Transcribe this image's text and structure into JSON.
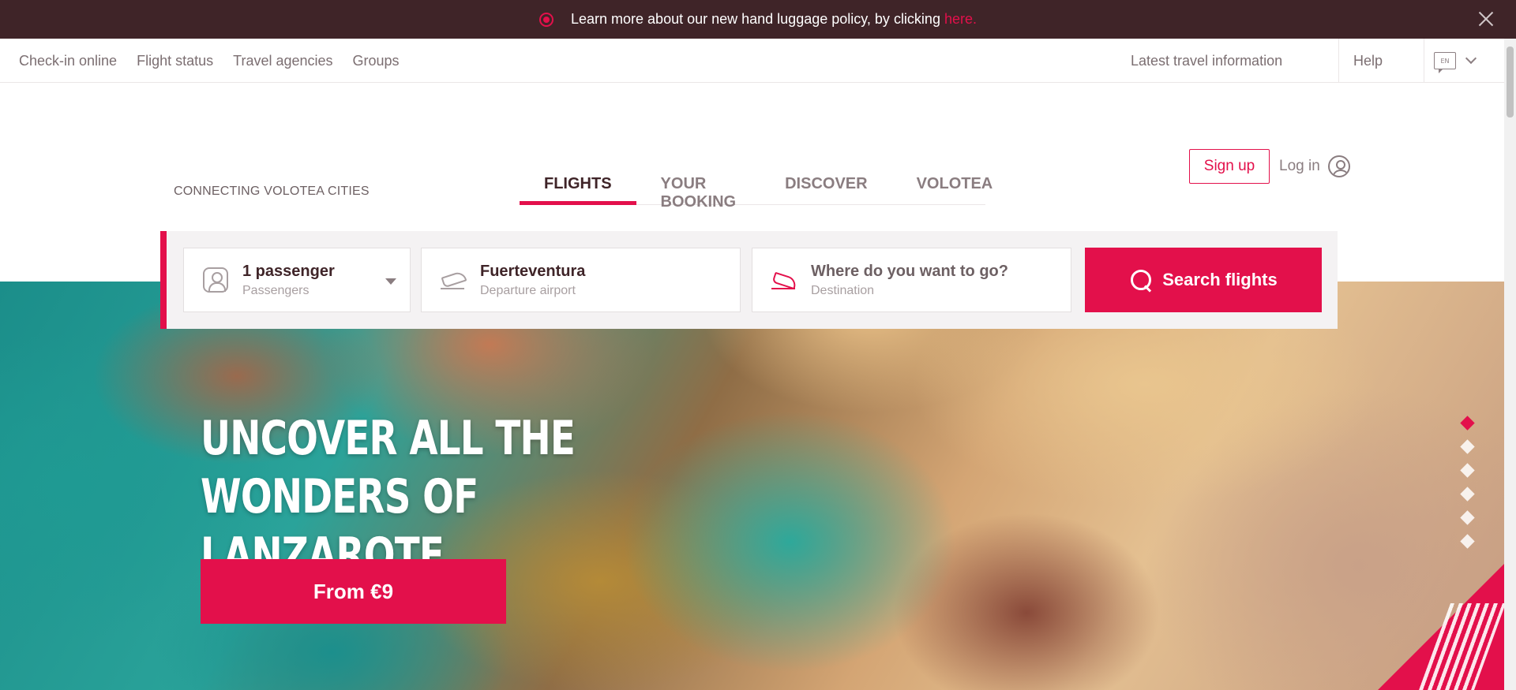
{
  "announcement": {
    "text": "Learn more about our new hand luggage policy, by clicking",
    "link": "here."
  },
  "utility_nav": {
    "items": [
      {
        "label": "Check-in online"
      },
      {
        "label": "Flight status"
      },
      {
        "label": "Travel agencies"
      },
      {
        "label": "Groups"
      }
    ],
    "latest_travel_info": "Latest travel information",
    "help": "Help",
    "language_code": "EN"
  },
  "header": {
    "tagline": "CONNECTING VOLOTEA CITIES",
    "tabs": [
      {
        "label": "FLIGHTS",
        "active": true
      },
      {
        "label": "YOUR BOOKING",
        "active": false
      },
      {
        "label": "DISCOVER",
        "active": false
      },
      {
        "label": "VOLOTEA",
        "active": false
      }
    ],
    "signup": "Sign up",
    "login": "Log in"
  },
  "search": {
    "passengers": {
      "value": "1 passenger",
      "label": "Passengers"
    },
    "departure": {
      "value": "Fuerteventura",
      "label": "Departure airport"
    },
    "destination": {
      "placeholder": "Where do you want to go?",
      "label": "Destination"
    },
    "button": "Search flights"
  },
  "hero": {
    "title_line1": "UNCOVER ALL THE WONDERS OF",
    "title_line2": "LANZAROTE",
    "cta": "From €9",
    "slides": 6,
    "active_slide": 1
  },
  "colors": {
    "brand": "#e3104b",
    "announcement_bg": "#3f2428"
  }
}
